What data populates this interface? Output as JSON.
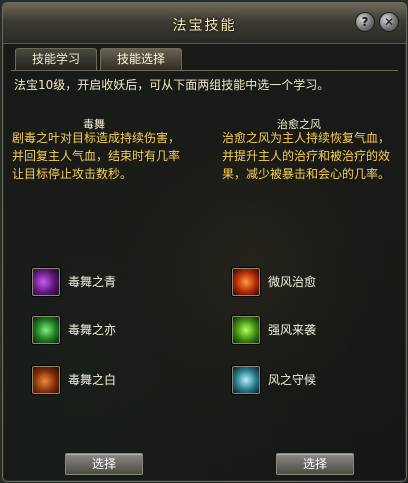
{
  "window": {
    "title": "法宝技能"
  },
  "titlebar": {
    "help_label": "?",
    "close_label": "✕"
  },
  "tabs": [
    {
      "label": "技能学习"
    },
    {
      "label": "技能选择"
    }
  ],
  "intro": "法宝10级，开启收妖后，可从下面两组技能中选一个学习。",
  "groups": [
    {
      "name": "毒舞",
      "description": "剧毒之叶对目标造成持续伤害，并回复主人气血，结束时有几率让目标停止攻击数秒。",
      "skills": [
        {
          "label": "毒舞之青",
          "icon": "purple-poison-leaf-icon"
        },
        {
          "label": "毒舞之亦",
          "icon": "green-poison-leaf-icon"
        },
        {
          "label": "毒舞之白",
          "icon": "orange-poison-leaf-icon"
        }
      ],
      "select_label": "选择"
    },
    {
      "name": "治愈之风",
      "description": "治愈之风为主人持续恢复气血，并提升主人的治疗和被治疗的效果，减少被暴击和会心的几率。",
      "skills": [
        {
          "label": "微风治愈",
          "icon": "fire-swirl-icon"
        },
        {
          "label": "强风来袭",
          "icon": "green-swirl-icon"
        },
        {
          "label": "风之守候",
          "icon": "cyan-swirl-icon"
        }
      ],
      "select_label": "选择"
    }
  ],
  "colors": {
    "description_text": "#f7cf55",
    "title_text": "#f2e7b8"
  }
}
